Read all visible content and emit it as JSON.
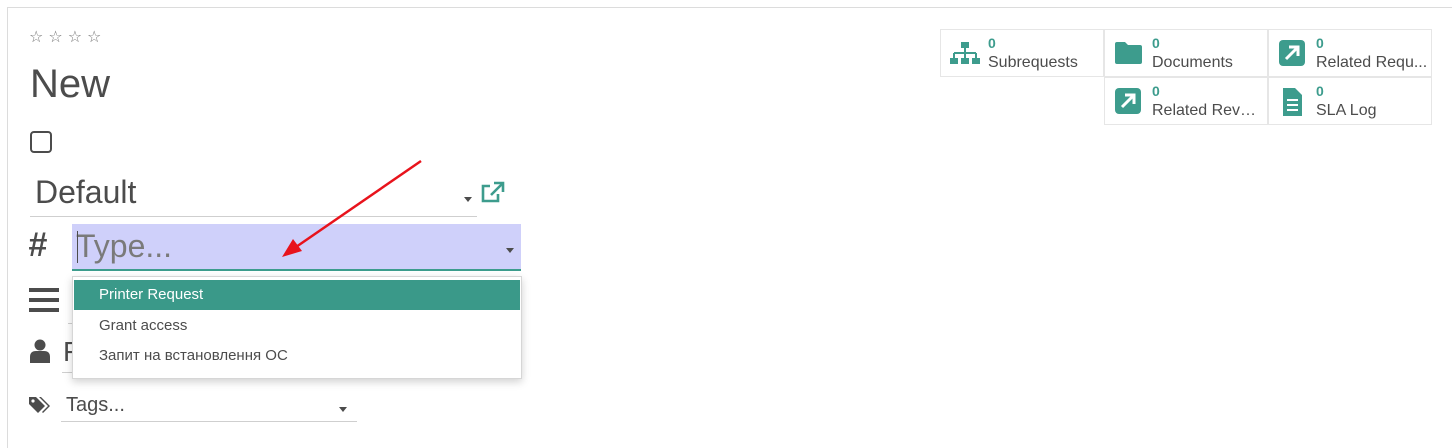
{
  "form": {
    "title": "New",
    "stars": [
      "☆",
      "☆",
      "☆",
      "☆"
    ],
    "default_field": {
      "value": "Default"
    },
    "type_field": {
      "placeholder": "Type..."
    },
    "partial_field_letter": "F",
    "tags_field": {
      "placeholder": "Tags..."
    }
  },
  "dropdown": {
    "items": [
      {
        "label": "Printer Request",
        "active": true
      },
      {
        "label": "Grant access",
        "active": false
      },
      {
        "label": "Запит на встановлення ОС",
        "active": false
      }
    ]
  },
  "smart_buttons": [
    {
      "count": "0",
      "label": "Subrequests",
      "icon": "sitemap-icon"
    },
    {
      "count": "0",
      "label": "Documents",
      "icon": "folder-icon"
    },
    {
      "count": "0",
      "label": "Related Requ...",
      "icon": "external-arrow-icon"
    },
    {
      "count": "0",
      "label": "Related Rever...",
      "icon": "external-arrow-icon"
    },
    {
      "count": "0",
      "label": "SLA Log",
      "icon": "document-icon"
    }
  ],
  "colors": {
    "accent": "#3d9c8d",
    "highlight_field": "#cfd0fa",
    "annotation_arrow": "#e8131c"
  }
}
